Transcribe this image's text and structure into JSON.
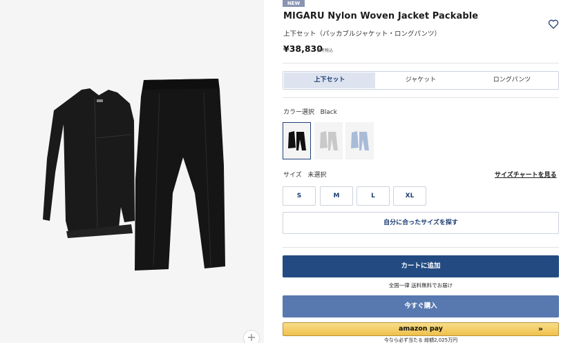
{
  "product": {
    "badge": "NEW",
    "title": "MIGARU Nylon Woven Jacket Packable",
    "subtitle": "上下セット（パッカブルジャケット・ロングパンツ）",
    "price": "¥38,830",
    "price_note": "参考税込"
  },
  "gallery": {
    "zoom_label": "+"
  },
  "variants": {
    "tabs": [
      {
        "label": "上下セット",
        "active": true
      },
      {
        "label": "ジャケット",
        "active": false
      },
      {
        "label": "ロングパンツ",
        "active": false
      }
    ]
  },
  "color": {
    "label": "カラー選択",
    "selected": "Black",
    "swatches": [
      {
        "name": "Black",
        "hex": "#1a1a1a"
      },
      {
        "name": "Gray",
        "hex": "#c9c9c9"
      },
      {
        "name": "Light Blue",
        "hex": "#a8bcd8"
      }
    ]
  },
  "size": {
    "label": "サイズ",
    "selected": "未選択",
    "chart_link": "サイズチャートを見る",
    "options": [
      "S",
      "M",
      "L",
      "XL"
    ],
    "find_size": "自分に合ったサイズを探す"
  },
  "purchase": {
    "cart": "カートに追加",
    "shipping": "全国一律 送料無料でお届け",
    "buy_now": "今すぐ購入",
    "amazon_pay": "amazon pay",
    "amazon_arrow": "»",
    "amazon_note": "今なら必ず当たる 総額2,025万円"
  },
  "colors": {
    "primary": "#234b82",
    "secondary": "#5878b0",
    "tab_active_bg": "#dde4ef",
    "amazon": "#f0c14b"
  }
}
